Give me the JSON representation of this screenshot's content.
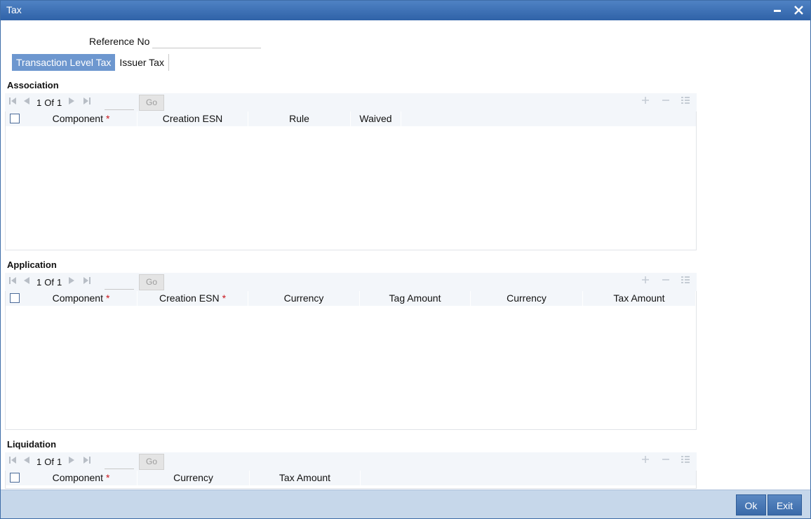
{
  "window": {
    "title": "Tax"
  },
  "reference": {
    "label": "Reference No",
    "value": ""
  },
  "tabs": [
    {
      "label": "Transaction Level Tax"
    },
    {
      "label": "Issuer Tax"
    }
  ],
  "association": {
    "title": "Association",
    "pager": {
      "current": "1",
      "of": "Of",
      "total": "1",
      "go": "Go"
    },
    "columns": [
      "Component",
      "Creation ESN",
      "Rule",
      "Waived"
    ]
  },
  "application": {
    "title": "Application",
    "pager": {
      "current": "1",
      "of": "Of",
      "total": "1",
      "go": "Go"
    },
    "columns": [
      "Component",
      "Creation ESN",
      "Currency",
      "Tag Amount",
      "Currency",
      "Tax Amount"
    ]
  },
  "liquidation": {
    "title": "Liquidation",
    "pager": {
      "current": "1",
      "of": "Of",
      "total": "1",
      "go": "Go"
    },
    "columns": [
      "Component",
      "Currency",
      "Tax Amount"
    ]
  },
  "footer": {
    "ok": "Ok",
    "exit": "Exit"
  },
  "required_marker": "*"
}
